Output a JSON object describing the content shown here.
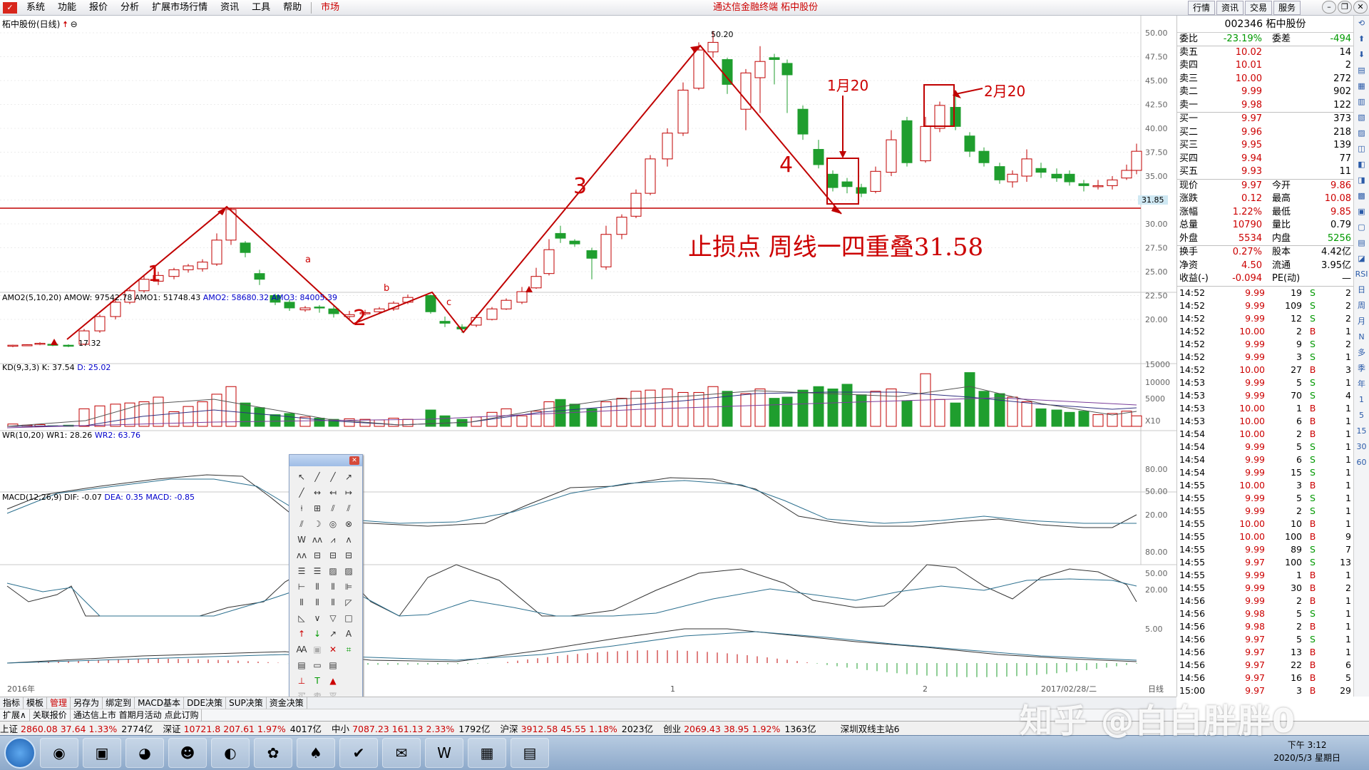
{
  "menu": {
    "items": [
      "系统",
      "功能",
      "报价",
      "分析",
      "扩展市场行情",
      "资讯",
      "工具",
      "帮助"
    ],
    "market": "市场",
    "app_title": "通达信金融终端  柘中股份",
    "top_tabs": [
      "行情",
      "资讯",
      "交易",
      "服务"
    ]
  },
  "chart": {
    "stock_title": "柘中股份(日线)",
    "price_axis": [
      "50.00",
      "47.50",
      "45.00",
      "42.50",
      "40.00",
      "37.50",
      "35.00",
      "32.50",
      "30.00",
      "27.50",
      "25.00",
      "22.50",
      "20.00"
    ],
    "current_price_tag": "31.85",
    "high_label": "50.20",
    "low_label": "17.32",
    "wave_labels": [
      "1",
      "2",
      "3",
      "4"
    ],
    "sub_wave_labels": [
      "a",
      "b",
      "c"
    ],
    "annotation_jan": "1月20",
    "annotation_feb": "2月20",
    "stoploss_note": "止损点 周线一四重叠31.58",
    "x_labels": [
      "2016年",
      "1",
      "2",
      "2017/02/28/二",
      "日线"
    ],
    "amo_axis": [
      "15000",
      "10000",
      "5000",
      "X10"
    ],
    "kd_axis": [
      "80.00",
      "50.00",
      "20.00"
    ],
    "wr_axis": [
      "80.00",
      "50.00",
      "20.00"
    ],
    "macd_axis": [
      "5.00"
    ],
    "amo_label": {
      "name": "AMO2(5,10,20)",
      "amow": "AMOW: 97542.78",
      "amo1": "AMO1: 51748.43",
      "amo2": "AMO2: 58680.32",
      "amo3": "AMO3: 84005.39"
    },
    "kd_label": {
      "name": "KD(9,3,3)",
      "k": "K: 37.54",
      "d": "D: 25.02"
    },
    "wr_label": {
      "name": "WR(10,20)",
      "wr1": "WR1: 28.26",
      "wr2": "WR2: 63.76"
    },
    "macd_label": {
      "name": "MACD(12,26,9)",
      "dif": "DIF: -0.07",
      "dea": "DEA: 0.35",
      "macd": "MACD: -0.85"
    }
  },
  "quote": {
    "header": "002346 柘中股份",
    "weibi_label": "委比",
    "weibi": "-23.19%",
    "weicha_label": "委差",
    "weicha": "-494",
    "asks": [
      {
        "label": "卖五",
        "price": "10.02",
        "vol": "14"
      },
      {
        "label": "卖四",
        "price": "10.01",
        "vol": "2"
      },
      {
        "label": "卖三",
        "price": "10.00",
        "vol": "272"
      },
      {
        "label": "卖二",
        "price": "9.99",
        "vol": "902"
      },
      {
        "label": "卖一",
        "price": "9.98",
        "vol": "122"
      }
    ],
    "bids": [
      {
        "label": "买一",
        "price": "9.97",
        "vol": "373"
      },
      {
        "label": "买二",
        "price": "9.96",
        "vol": "218"
      },
      {
        "label": "买三",
        "price": "9.95",
        "vol": "139"
      },
      {
        "label": "买四",
        "price": "9.94",
        "vol": "77"
      },
      {
        "label": "买五",
        "price": "9.93",
        "vol": "11"
      }
    ],
    "stats": [
      {
        "l1": "现价",
        "v1": "9.97",
        "l2": "今开",
        "v2": "9.86"
      },
      {
        "l1": "涨跌",
        "v1": "0.12",
        "l2": "最高",
        "v2": "10.08"
      },
      {
        "l1": "涨幅",
        "v1": "1.22%",
        "l2": "最低",
        "v2": "9.85"
      },
      {
        "l1": "总量",
        "v1": "10790",
        "l2": "量比",
        "v2": "0.79"
      },
      {
        "l1": "外盘",
        "v1": "5534",
        "l2": "内盘",
        "v2": "5256"
      }
    ],
    "stats2": [
      {
        "l1": "换手",
        "v1": "0.27%",
        "l2": "股本",
        "v2": "4.42亿"
      },
      {
        "l1": "净资",
        "v1": "4.50",
        "l2": "流通",
        "v2": "3.95亿"
      },
      {
        "l1": "收益(-)",
        "v1": "-0.094",
        "l2": "PE(动)",
        "v2": "—"
      }
    ],
    "ticks": [
      {
        "t": "14:52",
        "p": "9.99",
        "v": "19",
        "s": "S",
        "n": "2"
      },
      {
        "t": "14:52",
        "p": "9.99",
        "v": "109",
        "s": "S",
        "n": "2"
      },
      {
        "t": "14:52",
        "p": "9.99",
        "v": "12",
        "s": "S",
        "n": "2"
      },
      {
        "t": "14:52",
        "p": "10.00",
        "v": "2",
        "s": "B",
        "n": "1"
      },
      {
        "t": "14:52",
        "p": "9.99",
        "v": "9",
        "s": "S",
        "n": "2"
      },
      {
        "t": "14:52",
        "p": "9.99",
        "v": "3",
        "s": "S",
        "n": "1"
      },
      {
        "t": "14:52",
        "p": "10.00",
        "v": "27",
        "s": "B",
        "n": "3"
      },
      {
        "t": "14:53",
        "p": "9.99",
        "v": "5",
        "s": "S",
        "n": "1"
      },
      {
        "t": "14:53",
        "p": "9.99",
        "v": "70",
        "s": "S",
        "n": "4"
      },
      {
        "t": "14:53",
        "p": "10.00",
        "v": "1",
        "s": "B",
        "n": "1"
      },
      {
        "t": "14:53",
        "p": "10.00",
        "v": "6",
        "s": "B",
        "n": "1"
      },
      {
        "t": "14:54",
        "p": "10.00",
        "v": "2",
        "s": "B",
        "n": "1"
      },
      {
        "t": "14:54",
        "p": "9.99",
        "v": "5",
        "s": "S",
        "n": "1"
      },
      {
        "t": "14:54",
        "p": "9.99",
        "v": "6",
        "s": "S",
        "n": "1"
      },
      {
        "t": "14:54",
        "p": "9.99",
        "v": "15",
        "s": "S",
        "n": "1"
      },
      {
        "t": "14:55",
        "p": "10.00",
        "v": "3",
        "s": "B",
        "n": "1"
      },
      {
        "t": "14:55",
        "p": "9.99",
        "v": "5",
        "s": "S",
        "n": "1"
      },
      {
        "t": "14:55",
        "p": "9.99",
        "v": "2",
        "s": "S",
        "n": "1"
      },
      {
        "t": "14:55",
        "p": "10.00",
        "v": "10",
        "s": "B",
        "n": "1"
      },
      {
        "t": "14:55",
        "p": "10.00",
        "v": "100",
        "s": "B",
        "n": "9"
      },
      {
        "t": "14:55",
        "p": "9.99",
        "v": "89",
        "s": "S",
        "n": "7"
      },
      {
        "t": "14:55",
        "p": "9.97",
        "v": "100",
        "s": "S",
        "n": "13"
      },
      {
        "t": "14:55",
        "p": "9.99",
        "v": "1",
        "s": "B",
        "n": "1"
      },
      {
        "t": "14:55",
        "p": "9.99",
        "v": "30",
        "s": "B",
        "n": "2"
      },
      {
        "t": "14:56",
        "p": "9.99",
        "v": "2",
        "s": "B",
        "n": "1"
      },
      {
        "t": "14:56",
        "p": "9.98",
        "v": "5",
        "s": "S",
        "n": "1"
      },
      {
        "t": "14:56",
        "p": "9.98",
        "v": "2",
        "s": "B",
        "n": "1"
      },
      {
        "t": "14:56",
        "p": "9.97",
        "v": "5",
        "s": "S",
        "n": "1"
      },
      {
        "t": "14:56",
        "p": "9.97",
        "v": "13",
        "s": "B",
        "n": "1"
      },
      {
        "t": "14:56",
        "p": "9.97",
        "v": "22",
        "s": "B",
        "n": "6"
      },
      {
        "t": "14:56",
        "p": "9.97",
        "v": "16",
        "s": "B",
        "n": "5"
      },
      {
        "t": "15:00",
        "p": "9.97",
        "v": "3",
        "s": "B",
        "n": "29"
      }
    ]
  },
  "side_tools": [
    "RSI",
    "日",
    "周",
    "月",
    "N",
    "多",
    "季",
    "年",
    "1",
    "5",
    "15",
    "30",
    "60"
  ],
  "bottom_tabs": [
    "指标",
    "模板",
    "管理",
    "另存为",
    "绑定到",
    "MACD基本",
    "DDE决策",
    "SUP决策",
    "资金决策"
  ],
  "bottom_tabs2": [
    "扩展∧",
    "关联报价",
    "通达信上市 首期月活动 点此订购"
  ],
  "indices": [
    {
      "name": "上证",
      "val": "2860.08",
      "chg": "37.64",
      "pct": "1.33%",
      "amt": "2774亿"
    },
    {
      "name": "深证",
      "val": "10721.8",
      "chg": "207.61",
      "pct": "1.97%",
      "amt": "4017亿"
    },
    {
      "name": "中小",
      "val": "7087.23",
      "chg": "161.13",
      "pct": "2.33%",
      "amt": "1792亿"
    },
    {
      "name": "沪深",
      "val": "3912.58",
      "chg": "45.55",
      "pct": "1.18%",
      "amt": "2023亿"
    },
    {
      "name": "创业",
      "val": "2069.43",
      "chg": "38.95",
      "pct": "1.92%",
      "amt": "1363亿"
    }
  ],
  "server": "深圳双线主站6",
  "clock": {
    "time": "下午 3:12",
    "date": "2020/5/3 星期日"
  },
  "watermark": "知乎 @白白胖胖0",
  "palette_bottom": [
    "买",
    "卖",
    "平"
  ],
  "colors": {
    "up": "#c00000",
    "down": "#1f9e2e",
    "line": "#c00000"
  }
}
